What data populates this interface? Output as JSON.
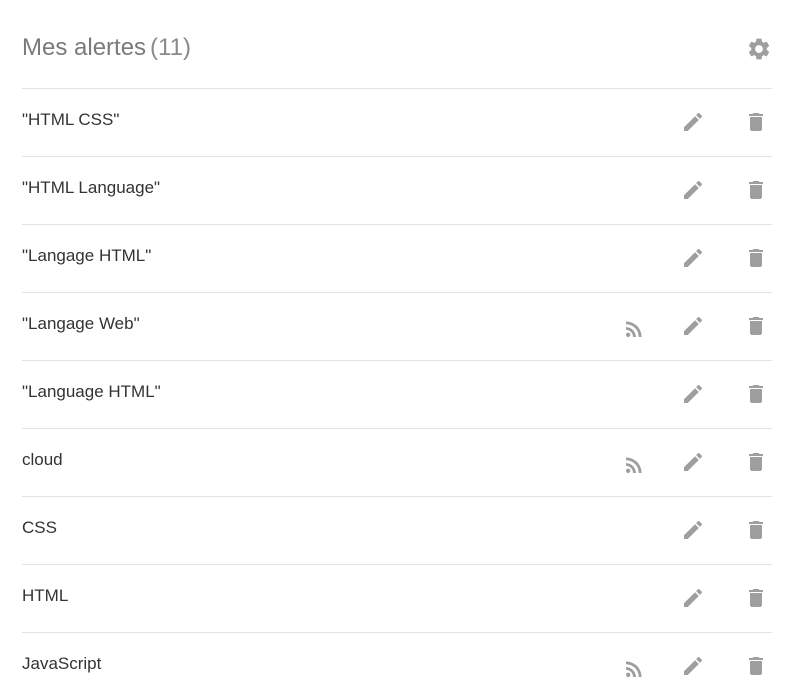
{
  "header": {
    "title": "Mes alertes",
    "count": "(11)",
    "settings_icon": "gear-icon"
  },
  "colors": {
    "icon": "#9e9e9e",
    "divider": "#e3e3e3",
    "title": "#7a7a7a",
    "text": "#333333"
  },
  "alerts": [
    {
      "label": "\"HTML CSS\"",
      "rss": false
    },
    {
      "label": "\"HTML Language\"",
      "rss": false
    },
    {
      "label": "\"Langage HTML\"",
      "rss": false
    },
    {
      "label": "\"Langage Web\"",
      "rss": true
    },
    {
      "label": "\"Language HTML\"",
      "rss": false
    },
    {
      "label": "cloud",
      "rss": true
    },
    {
      "label": "CSS",
      "rss": false
    },
    {
      "label": "HTML",
      "rss": false
    },
    {
      "label": "JavaScript",
      "rss": true
    }
  ],
  "icons": {
    "rss": "rss-icon",
    "edit": "pencil-icon",
    "delete": "trash-icon"
  }
}
